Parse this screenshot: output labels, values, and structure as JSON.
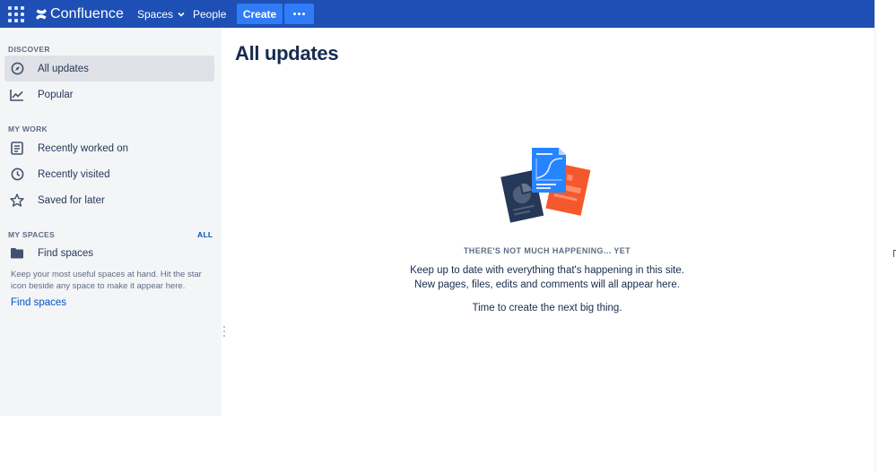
{
  "header": {
    "product_name": "Confluence",
    "nav": {
      "spaces": "Spaces",
      "people": "People"
    },
    "create_label": "Create",
    "more_icon": "more-horizontal-icon",
    "apps_icon": "app-switcher-icon",
    "brand_color": "#1e4fb4",
    "button_color": "#2f7cf6"
  },
  "sidebar": {
    "discover_heading": "DISCOVER",
    "discover_items": [
      {
        "label": "All updates",
        "icon": "compass-icon",
        "active": true
      },
      {
        "label": "Popular",
        "icon": "trending-chart-icon",
        "active": false
      }
    ],
    "my_work_heading": "MY WORK",
    "my_work_items": [
      {
        "label": "Recently worked on",
        "icon": "document-list-icon"
      },
      {
        "label": "Recently visited",
        "icon": "clock-icon"
      },
      {
        "label": "Saved for later",
        "icon": "star-icon"
      }
    ],
    "my_spaces_heading": "MY SPACES",
    "all_link": "ALL",
    "find_spaces_item": {
      "label": "Find spaces",
      "icon": "folder-icon"
    },
    "hint": "Keep your most useful spaces at hand. Hit the star icon beside any space to make it appear here.",
    "find_spaces_link": "Find spaces"
  },
  "main": {
    "title": "All updates",
    "empty_state": {
      "heading": "THERE'S NOT MUCH HAPPENING... YET",
      "line1": "Keep up to date with everything that's happening in this site.",
      "line2": "New pages, files, edits and comments will all appear here.",
      "line3": "Time to create the next big thing."
    }
  }
}
